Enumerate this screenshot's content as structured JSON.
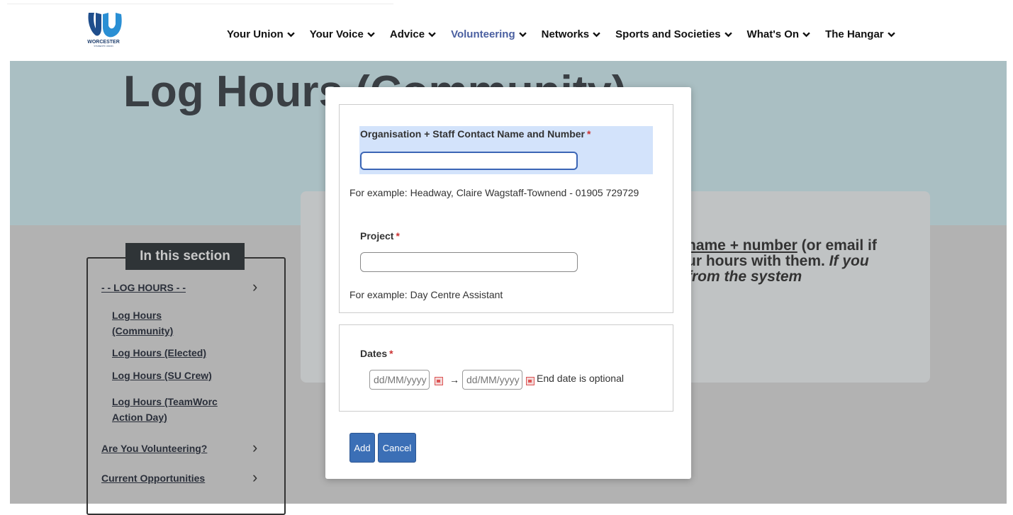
{
  "header": {
    "logo_text": "WORCESTER",
    "logo_subtext": "STUDENTS' UNION",
    "nav": [
      {
        "label": "Your Union",
        "active": false
      },
      {
        "label": "Your Voice",
        "active": false
      },
      {
        "label": "Advice",
        "active": false
      },
      {
        "label": "Volunteering",
        "active": true
      },
      {
        "label": "Networks",
        "active": false
      },
      {
        "label": "Sports and Societies",
        "active": false
      },
      {
        "label": "What's On",
        "active": false
      },
      {
        "label": "The Hangar",
        "active": false
      }
    ]
  },
  "page": {
    "title": "Log Hours (Community)",
    "content_text_line1_u": "name + number",
    "content_text_line1_rest": " (or email if",
    "content_text_line2": "ur hours with them. ",
    "content_text_line2_i": "If you",
    "content_text_line3_i": "from the system"
  },
  "sidebar": {
    "title": "In this section",
    "items": [
      {
        "label": "- - LOG HOURS - -",
        "has_chevron": true
      },
      {
        "label": "Log Hours (Community)",
        "has_chevron": false
      },
      {
        "label": "Log Hours (Elected)",
        "has_chevron": false
      },
      {
        "label": "Log Hours (SU Crew)",
        "has_chevron": false
      },
      {
        "label": "Log Hours (TeamWorc Action Day)",
        "has_chevron": false
      },
      {
        "label": "Are You Volunteering?",
        "has_chevron": true
      },
      {
        "label": "Current Opportunities",
        "has_chevron": true
      }
    ],
    "subitem_lines": {
      "community_1": "Log Hours",
      "community_2": "(Community)",
      "teamworc_1": "Log Hours (TeamWorc",
      "teamworc_2": "Action Day)"
    }
  },
  "modal": {
    "org_label": "Organisation + Staff Contact Name and Number",
    "org_value": "",
    "org_help": "For example: Headway, Claire Wagstaff-Townend - 01905 729729",
    "project_label": "Project",
    "project_value": "",
    "project_help": "For example: Day Centre Assistant",
    "dates_label": "Dates",
    "date_start_placeholder": "dd/MM/yyyy",
    "date_end_placeholder": "dd/MM/yyyy",
    "date_arrow": "→",
    "dates_help": "End date is optional",
    "required_mark": "*",
    "add_label": "Add",
    "cancel_label": "Cancel"
  },
  "colors": {
    "accent": "#3b6fb6",
    "nav_active": "#4a5fa0",
    "hero_bg": "#aabfc3",
    "highlight": "#d3e3fb",
    "required": "#cc3333"
  }
}
